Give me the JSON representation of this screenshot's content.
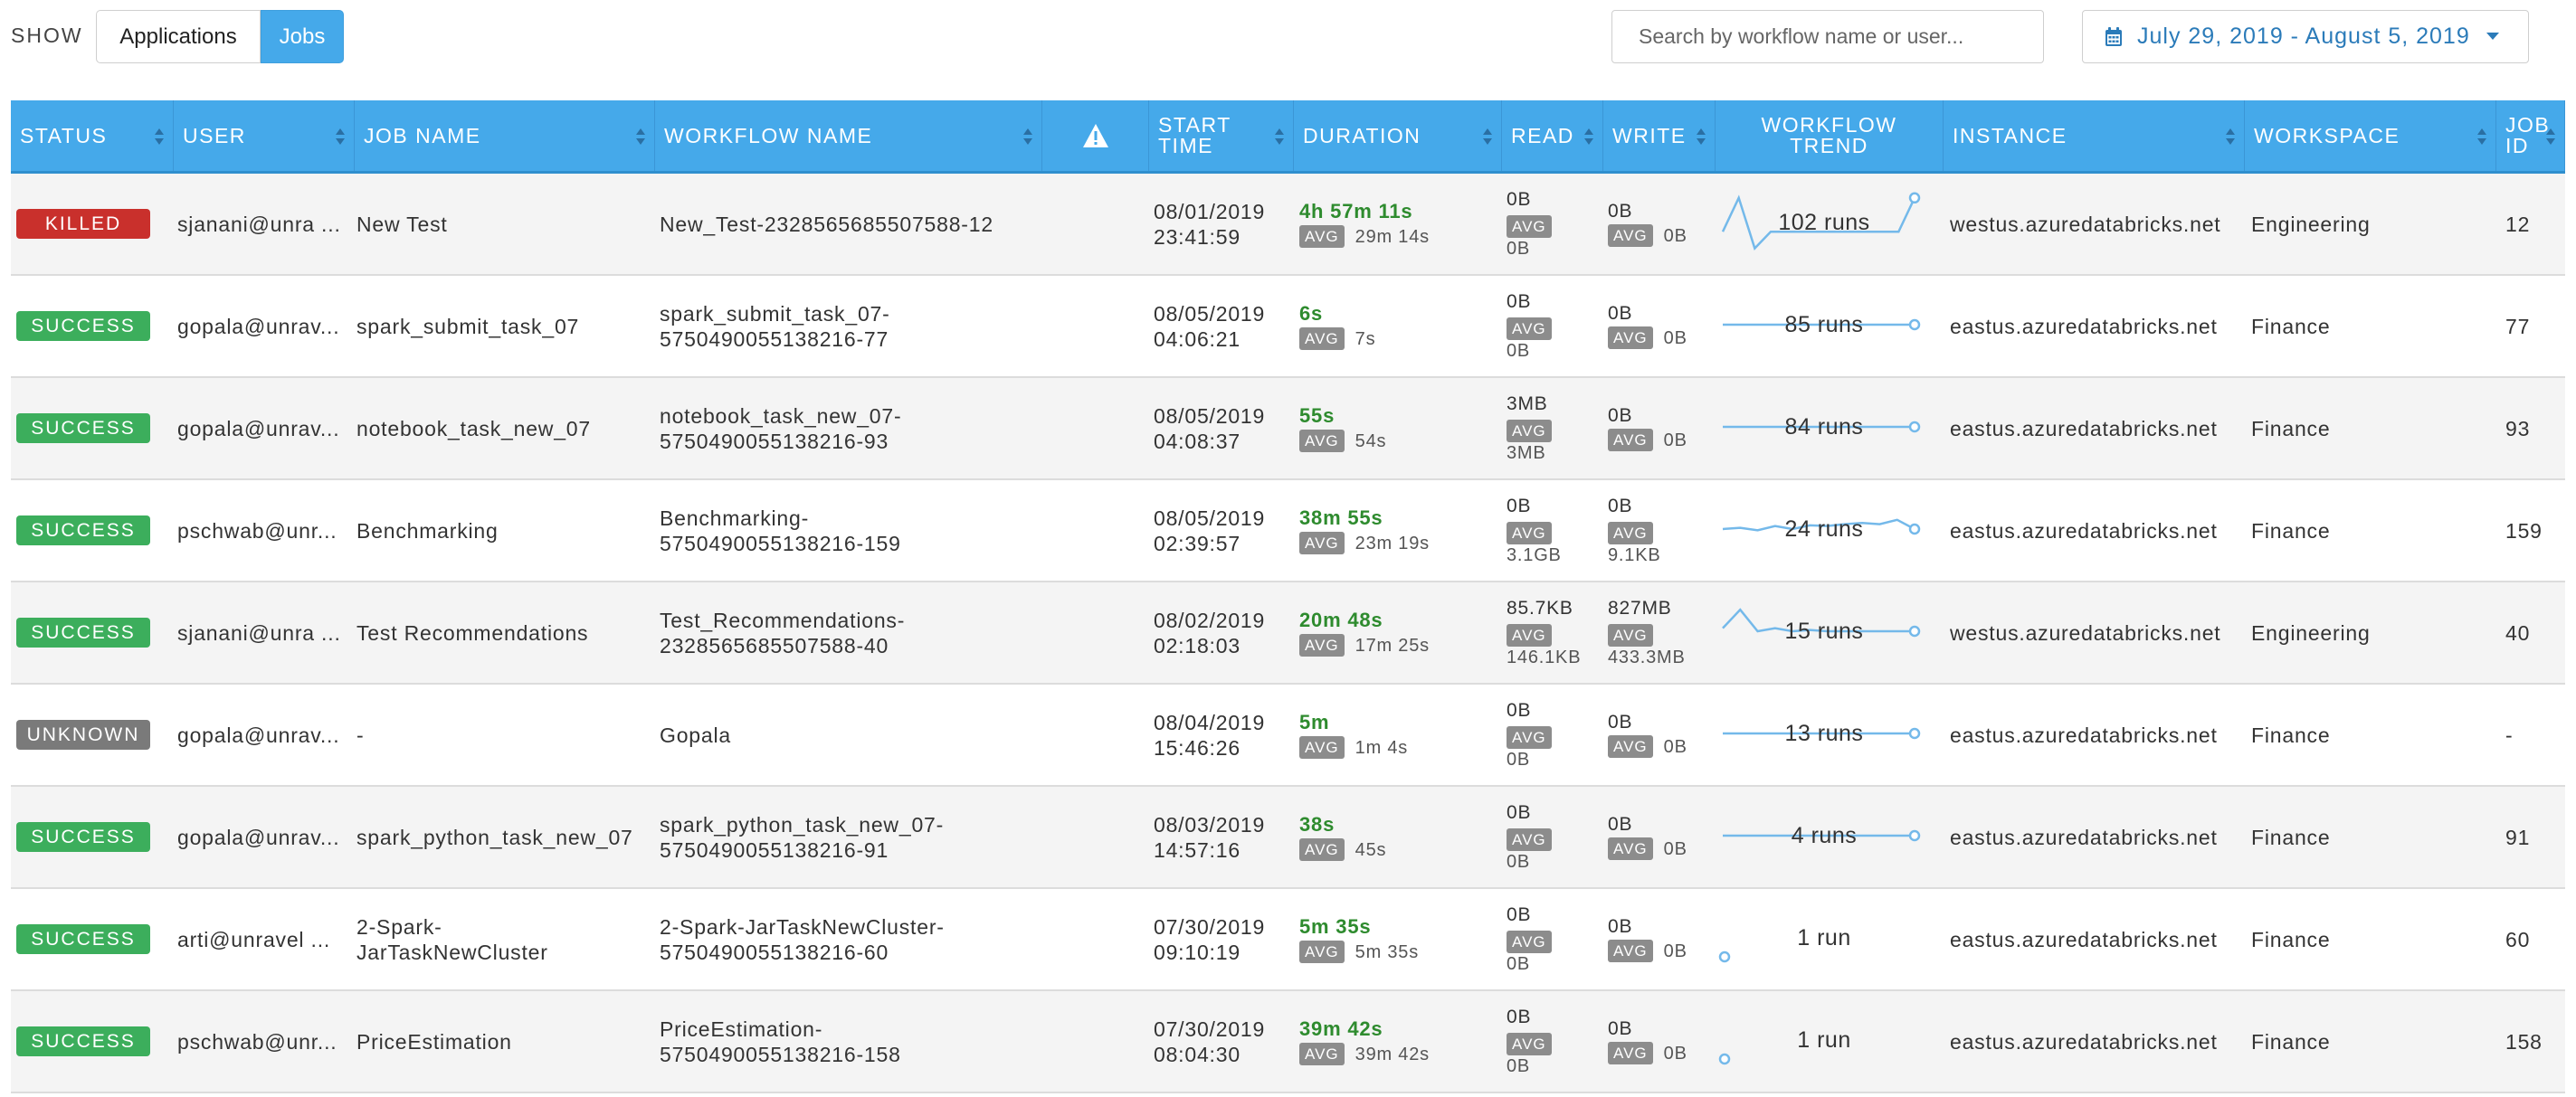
{
  "toolbar": {
    "show_label": "SHOW",
    "tabs": [
      {
        "label": "Applications",
        "active": false
      },
      {
        "label": "Jobs",
        "active": true
      }
    ],
    "search_placeholder": "Search by workflow name or user...",
    "date_range": "July 29, 2019 - August 5, 2019",
    "accent_color": "#45a9ea"
  },
  "table": {
    "headers": {
      "status": "STATUS",
      "user": "USER",
      "job_name": "JOB NAME",
      "workflow_name": "WORKFLOW NAME",
      "alert_icon": "warning-icon",
      "start_time_1": "START",
      "start_time_2": "TIME",
      "duration": "DURATION",
      "read": "READ",
      "write": "WRITE",
      "trend_1": "WORKFLOW",
      "trend_2": "TREND",
      "instance": "INSTANCE",
      "workspace": "WORKSPACE",
      "job_id_1": "JOB",
      "job_id_2": "ID"
    },
    "status_colors": {
      "KILLED": "#c9302c",
      "SUCCESS": "#3cae5c",
      "UNKNOWN": "#7a7a7a"
    },
    "avg_label": "AVG",
    "rows": [
      {
        "status": "KILLED",
        "user": "sjanani@unra ...",
        "job_name": "New Test",
        "job_name_2": "",
        "workflow_1": "New_Test-2328565685507588-12",
        "workflow_2": "",
        "start_date": "08/01/2019",
        "start_time": "23:41:59",
        "duration": "4h 57m 11s",
        "duration_avg": "29m 14s",
        "read": "0B",
        "read_avg": "0B",
        "write": "0B",
        "write_avg": "0B",
        "write_avg_inline": true,
        "runs": "102 runs",
        "trend": [
          0.35,
          0.9,
          0.08,
          0.35,
          0.35,
          0.35,
          0.35,
          0.35,
          0.35,
          0.35,
          0.35,
          0.35,
          0.9
        ],
        "instance": "westus.azuredatabricks.net",
        "workspace": "Engineering",
        "job_id": "12"
      },
      {
        "status": "SUCCESS",
        "user": "gopala@unrav...",
        "job_name": "spark_submit_task_07",
        "job_name_2": "",
        "workflow_1": "spark_submit_task_07-",
        "workflow_2": "5750490055138216-77",
        "start_date": "08/05/2019",
        "start_time": "04:06:21",
        "duration": "6s",
        "duration_avg": "7s",
        "read": "0B",
        "read_avg": "0B",
        "write": "0B",
        "write_avg": "0B",
        "write_avg_inline": true,
        "runs": "85 runs",
        "trend": [
          0.5,
          0.5,
          0.5,
          0.5,
          0.5,
          0.5,
          0.5
        ],
        "instance": "eastus.azuredatabricks.net",
        "workspace": "Finance",
        "job_id": "77"
      },
      {
        "status": "SUCCESS",
        "user": "gopala@unrav...",
        "job_name": "notebook_task_new_07",
        "job_name_2": "",
        "workflow_1": "notebook_task_new_07-",
        "workflow_2": "5750490055138216-93",
        "start_date": "08/05/2019",
        "start_time": "04:08:37",
        "duration": "55s",
        "duration_avg": "54s",
        "read": "3MB",
        "read_avg": "3MB",
        "write": "0B",
        "write_avg": "0B",
        "write_avg_inline": true,
        "runs": "84 runs",
        "trend": [
          0.5,
          0.5,
          0.5,
          0.5,
          0.5,
          0.5,
          0.5
        ],
        "instance": "eastus.azuredatabricks.net",
        "workspace": "Finance",
        "job_id": "93"
      },
      {
        "status": "SUCCESS",
        "user": "pschwab@unr...",
        "job_name": "Benchmarking",
        "job_name_2": "",
        "workflow_1": "Benchmarking-",
        "workflow_2": "5750490055138216-159",
        "start_date": "08/05/2019",
        "start_time": "02:39:57",
        "duration": "38m 55s",
        "duration_avg": "23m 19s",
        "read": "0B",
        "read_avg": "3.1GB",
        "write": "0B",
        "write_avg": "9.1KB",
        "write_avg_inline": false,
        "runs": "24 runs",
        "trend": [
          0.5,
          0.52,
          0.48,
          0.55,
          0.5,
          0.56,
          0.55,
          0.58,
          0.6,
          0.58,
          0.65,
          0.5
        ],
        "instance": "eastus.azuredatabricks.net",
        "workspace": "Finance",
        "job_id": "159"
      },
      {
        "status": "SUCCESS",
        "user": "sjanani@unra ...",
        "job_name": "Test Recommendations",
        "job_name_2": "",
        "workflow_1": "Test_Recommendations-",
        "workflow_2": "2328565685507588-40",
        "start_date": "08/02/2019",
        "start_time": "02:18:03",
        "duration": "20m 48s",
        "duration_avg": "17m 25s",
        "read": "85.7KB",
        "read_avg": "146.1KB",
        "write": "827MB",
        "write_avg": "433.3MB",
        "write_avg_inline": false,
        "runs": "15 runs",
        "trend": [
          0.55,
          0.85,
          0.5,
          0.55,
          0.5,
          0.52,
          0.5,
          0.5,
          0.5,
          0.5,
          0.5,
          0.5
        ],
        "instance": "westus.azuredatabricks.net",
        "workspace": "Engineering",
        "job_id": "40"
      },
      {
        "status": "UNKNOWN",
        "user": "gopala@unrav...",
        "job_name": "-",
        "job_name_2": "",
        "workflow_1": "Gopala",
        "workflow_2": "",
        "start_date": "08/04/2019",
        "start_time": "15:46:26",
        "duration": "5m",
        "duration_avg": "1m 4s",
        "read": "0B",
        "read_avg": "0B",
        "write": "0B",
        "write_avg": "0B",
        "write_avg_inline": true,
        "runs": "13 runs",
        "trend": [
          0.5,
          0.5,
          0.5,
          0.5,
          0.5,
          0.5,
          0.5
        ],
        "instance": "eastus.azuredatabricks.net",
        "workspace": "Finance",
        "job_id": "-"
      },
      {
        "status": "SUCCESS",
        "user": "gopala@unrav...",
        "job_name": "spark_python_task_new_07",
        "job_name_2": "",
        "workflow_1": "spark_python_task_new_07-",
        "workflow_2": "5750490055138216-91",
        "start_date": "08/03/2019",
        "start_time": "14:57:16",
        "duration": "38s",
        "duration_avg": "45s",
        "read": "0B",
        "read_avg": "0B",
        "write": "0B",
        "write_avg": "0B",
        "write_avg_inline": true,
        "runs": "4 runs",
        "trend": [
          0.5,
          0.5,
          0.5,
          0.5
        ],
        "instance": "eastus.azuredatabricks.net",
        "workspace": "Finance",
        "job_id": "91"
      },
      {
        "status": "SUCCESS",
        "user": "arti@unravel ...",
        "job_name": "2-Spark-",
        "job_name_2": "JarTaskNewCluster",
        "workflow_1": "2-Spark-JarTaskNewCluster-",
        "workflow_2": "5750490055138216-60",
        "start_date": "07/30/2019",
        "start_time": "09:10:19",
        "duration": "5m 35s",
        "duration_avg": "5m 35s",
        "read": "0B",
        "read_avg": "0B",
        "write": "0B",
        "write_avg": "0B",
        "write_avg_inline": true,
        "runs": "1 run",
        "trend": [
          0.5
        ],
        "instance": "eastus.azuredatabricks.net",
        "workspace": "Finance",
        "job_id": "60"
      },
      {
        "status": "SUCCESS",
        "user": "pschwab@unr...",
        "job_name": "PriceEstimation",
        "job_name_2": "",
        "workflow_1": "PriceEstimation-",
        "workflow_2": "5750490055138216-158",
        "start_date": "07/30/2019",
        "start_time": "08:04:30",
        "duration": "39m 42s",
        "duration_avg": "39m 42s",
        "read": "0B",
        "read_avg": "0B",
        "write": "0B",
        "write_avg": "0B",
        "write_avg_inline": true,
        "runs": "1 run",
        "trend": [
          0.5
        ],
        "instance": "eastus.azuredatabricks.net",
        "workspace": "Finance",
        "job_id": "158"
      }
    ]
  }
}
